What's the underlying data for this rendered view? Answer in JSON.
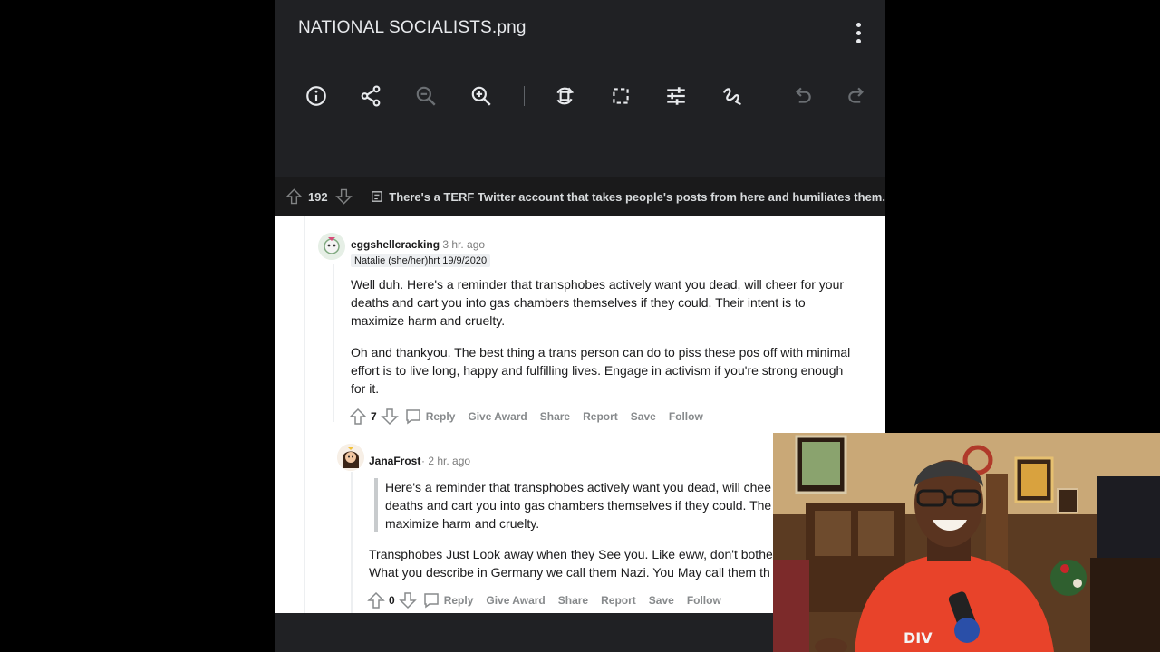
{
  "viewer": {
    "file_title": "NATIONAL SOCIALISTS.png",
    "toolbar_icons": [
      "info-icon",
      "share-icon",
      "zoom-out-icon",
      "zoom-in-icon",
      "rotate-icon",
      "crop-icon",
      "adjust-icon",
      "draw-icon",
      "undo-icon",
      "redo-icon"
    ]
  },
  "post_bar": {
    "score": "192",
    "title": "There's a TERF Twitter account that takes people's posts from here and humiliates them."
  },
  "comments": [
    {
      "username": "eggshellcracking",
      "time": "· 3 hr. ago",
      "flair": "Natalie (she/her)hrt 19/9/2020",
      "paragraphs": [
        [
          "Well duh. Here's a reminder that transphobes actively want you dead, will cheer for your",
          "deaths and cart you into gas chambers themselves if they could. Their intent is to",
          "maximize harm and cruelty."
        ],
        [
          "Oh and thankyou. The best thing a trans person can do to piss these pos off with minimal",
          "effort is to live long, happy and fulfilling lives. Engage in activism if you're strong enough",
          "for it."
        ]
      ],
      "votes": "7"
    },
    {
      "username": "JanaFrost",
      "time": "· 2 hr. ago",
      "quote": [
        "Here's a reminder that transphobes actively want you dead, will chee",
        "deaths and cart you into gas chambers themselves if they could. The",
        "maximize harm and cruelty."
      ],
      "paragraphs": [
        [
          "Transphobes Just Look away when they See you. Like eww, don't bother",
          "What you describe in Germany we call them Nazi. You May call them th"
        ]
      ],
      "votes": "0"
    }
  ],
  "actions": {
    "reply": "Reply",
    "give_award": "Give Award",
    "share": "Share",
    "report": "Report",
    "save": "Save",
    "follow": "Follow"
  },
  "webcam": {
    "shirt_text": "DIV"
  },
  "colors": {
    "viewer_bg": "#202124",
    "reddit_bar_bg": "#1a1a1b",
    "shirt": "#e8432a"
  }
}
